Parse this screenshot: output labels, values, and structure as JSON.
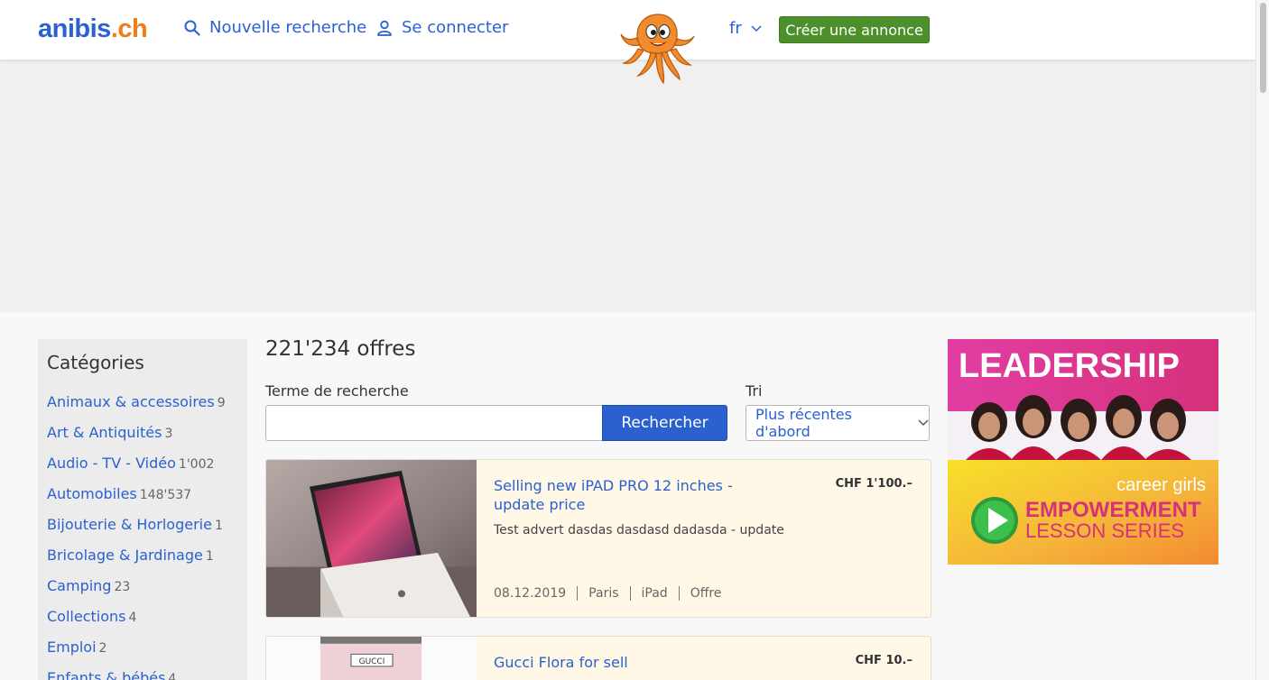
{
  "header": {
    "logo_main": "anibis",
    "logo_tld": ".ch",
    "new_search": "Nouvelle recherche",
    "login": "Se connecter",
    "language": "fr",
    "create_ad": "Créer une annonce"
  },
  "sidebar": {
    "title": "Catégories",
    "categories": [
      {
        "label": "Animaux & accessoires",
        "count": "9"
      },
      {
        "label": "Art & Antiquités",
        "count": "3"
      },
      {
        "label": "Audio - TV - Vidéo",
        "count": "1'002"
      },
      {
        "label": "Automobiles",
        "count": "148'537"
      },
      {
        "label": "Bijouterie & Horlogerie",
        "count": "1"
      },
      {
        "label": "Bricolage & Jardinage",
        "count": "1"
      },
      {
        "label": "Camping",
        "count": "23"
      },
      {
        "label": "Collections",
        "count": "4"
      },
      {
        "label": "Emploi",
        "count": "2"
      },
      {
        "label": "Enfants & bébés",
        "count": "4"
      }
    ]
  },
  "main": {
    "results_title": "221'234 offres",
    "search_label": "Terme de recherche",
    "search_value": "",
    "search_button": "Rechercher",
    "sort_label": "Tri",
    "sort_value": "Plus récentes d'abord"
  },
  "listings": [
    {
      "title": "Selling new iPAD PRO 12 inches - update price",
      "price": "CHF 1'100.–",
      "description": "Test advert dasdas dasdasd dadasda - update",
      "date": "08.12.2019",
      "location": "Paris",
      "category": "iPad",
      "type": "Offre"
    },
    {
      "title": "Gucci Flora for sell",
      "price": "CHF 10.–"
    }
  ],
  "ad_right": {
    "headline": "LEADERSHIP",
    "brand": "career girls",
    "line1": "EMPOWERMENT",
    "line2": "LESSON SERIES"
  },
  "colors": {
    "brand_blue": "#2a61cf",
    "brand_orange": "#f07e16",
    "create_green": "#4d8f2a",
    "listing_bg": "#fff8e6"
  }
}
